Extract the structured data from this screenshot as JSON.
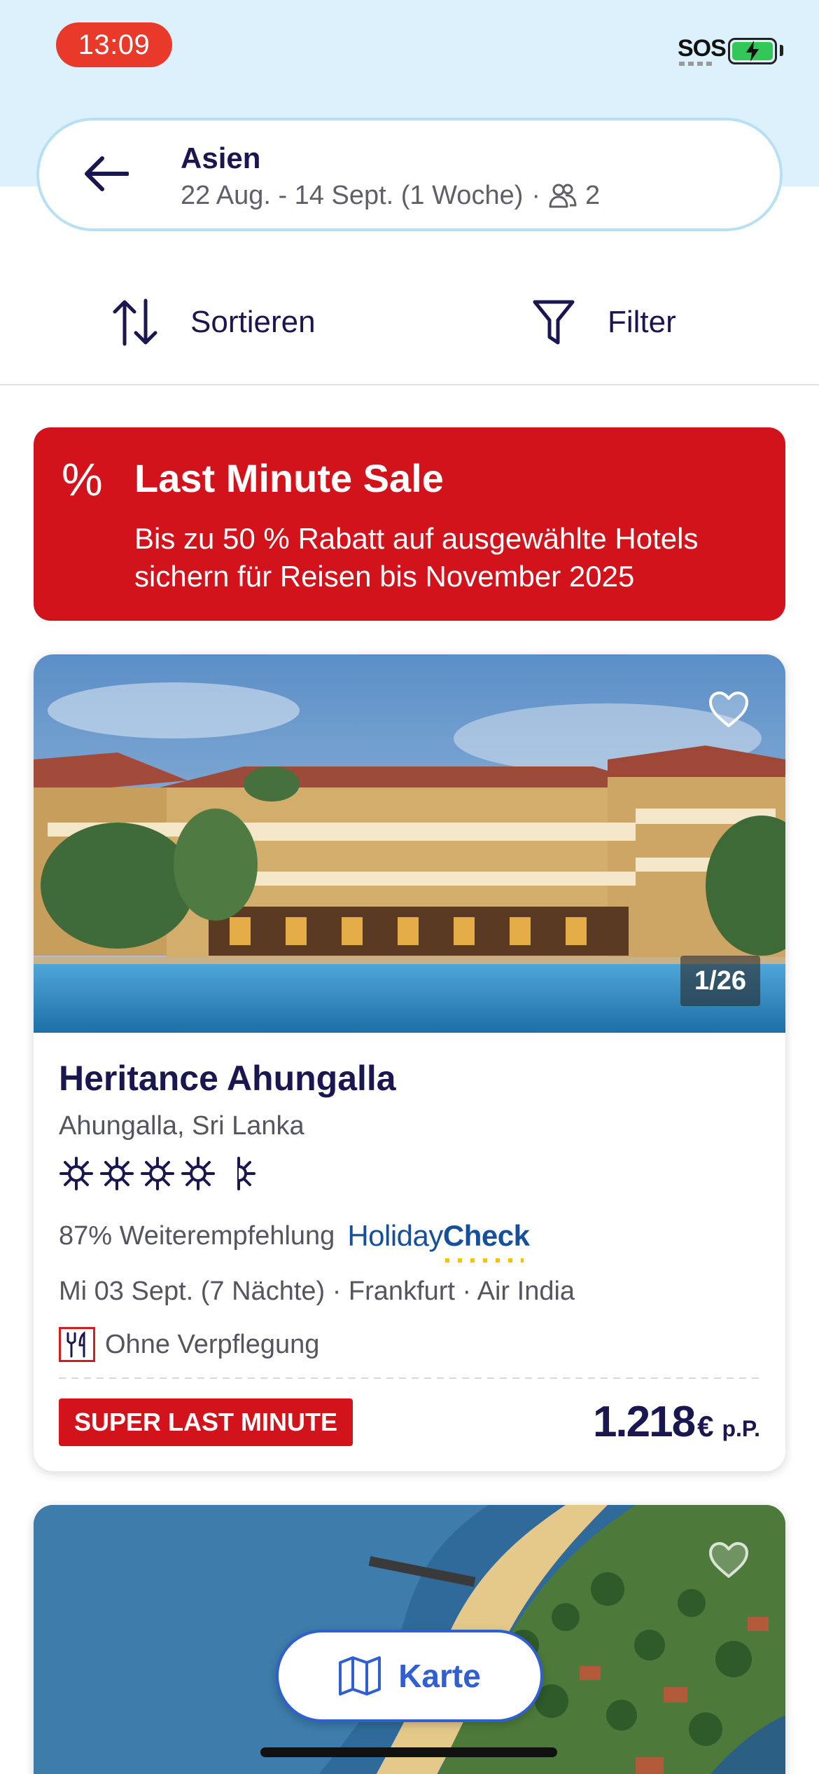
{
  "status_bar": {
    "time": "13:09",
    "sos": "SOS"
  },
  "search": {
    "destination": "Asien",
    "dates": "22 Aug. - 14 Sept. (1 Woche)",
    "separator": "·",
    "travellers": "2"
  },
  "toolbar": {
    "sort_label": "Sortieren",
    "filter_label": "Filter"
  },
  "promo": {
    "icon": "%",
    "title": "Last Minute Sale",
    "text": " Bis zu 50 % Rabatt auf ausgewählte Hotels\nsichern für Reisen bis November 2025"
  },
  "hotels": [
    {
      "image_counter": "1/26",
      "name": "Heritance Ahungalla",
      "location": "Ahungalla, Sri Lanka",
      "rating_suns": 4.5,
      "recommendation": "87% Weiterempfehlung",
      "rating_brand": "Holiday",
      "rating_brand_2": "Check",
      "trip": "Mi 03 Sept. (7 Nächte) · Frankfurt · Air India",
      "board": "Ohne Verpflegung",
      "badge": "SUPER LAST MINUTE",
      "price": "1.218",
      "currency": "€",
      "price_unit": "p.P."
    }
  ],
  "map_button": {
    "label": "Karte"
  },
  "colors": {
    "brand_navy": "#1a1650",
    "accent_red": "#d3131b",
    "map_blue": "#2f5fd0",
    "sky": "#dcf1fb"
  },
  "icons": [
    "back-arrow-icon",
    "people-icon",
    "sort-icon",
    "filter-icon",
    "heart-icon",
    "sun-icon",
    "cutlery-icon",
    "map-icon"
  ]
}
